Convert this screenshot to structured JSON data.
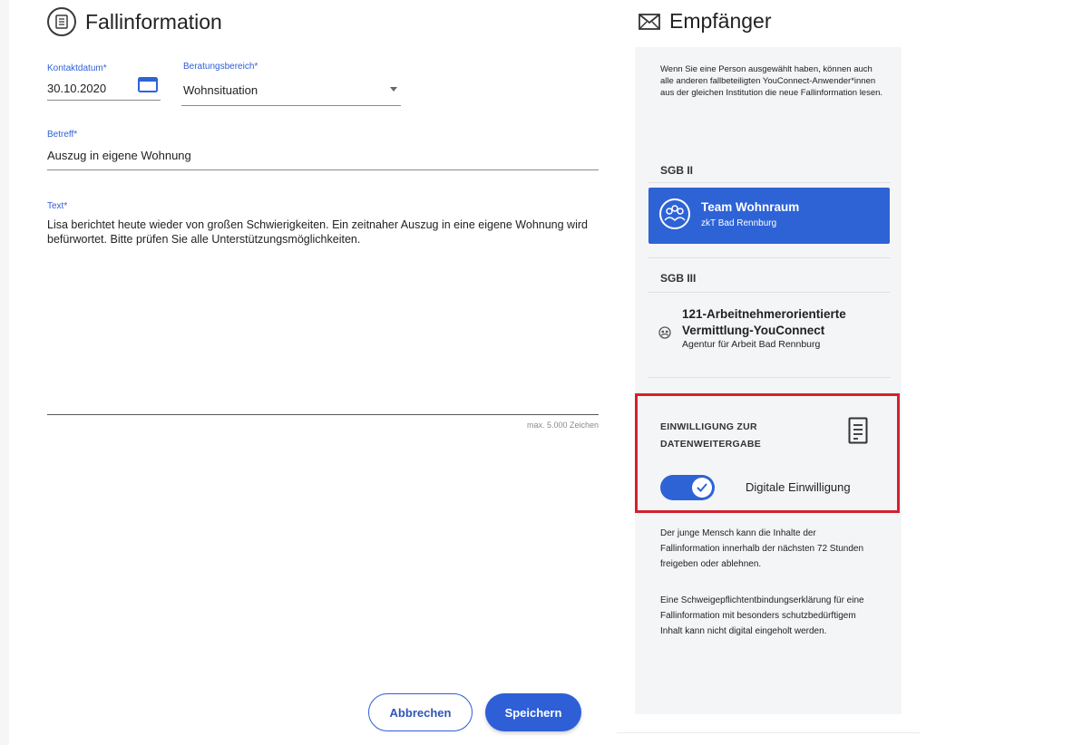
{
  "case": {
    "title": "Fallinformation",
    "contact_date_label": "Kontaktdatum*",
    "contact_date_value": "30.10.2020",
    "area_label": "Beratungsbereich*",
    "area_value": "Wohnsituation",
    "subject_label": "Betreff*",
    "subject_value": "Auszug in eigene Wohnung",
    "text_label": "Text*",
    "text_value": "Lisa berichtet heute wieder von großen Schwierigkeiten. Ein zeitnaher Auszug in eine eigene Wohnung wird befürwortet. Bitte prüfen Sie alle Unterstützungsmöglichkeiten.",
    "max_chars": "max. 5.000 Zeichen",
    "cancel_label": "Abbrechen",
    "save_label": "Speichern"
  },
  "recipients": {
    "title": "Empfänger",
    "info": "Wenn Sie eine Person ausgewählt haben, können auch alle anderen fallbeteiligten YouConnect-Anwender*innen aus der gleichen Institution die neue Fallinformation lesen.",
    "sgb2_label": "SGB II",
    "team_name": "Team Wohnraum",
    "team_org": "zkT Bad Rennburg",
    "sgb3_label": "SGB III",
    "agency_name": "121-Arbeitnehmerorientierte Vermittlung-YouConnect",
    "agency_org": "Agentur für Arbeit Bad Rennburg",
    "consent_title": "EINWILLIGUNG ZUR DATENWEITERGABE",
    "consent_toggle_label": "Digitale Einwilligung",
    "consent_enabled": true,
    "note1": "Der junge Mensch kann die Inhalte der Fallinformation innerhalb der nächsten 72 Stunden freigeben oder ablehnen.",
    "note2": "Eine Schweigepflichtentbindungserklärung für eine Fallinformation mit besonders schutzbedürftigem Inhalt kann nicht digital eingeholt werden."
  },
  "colors": {
    "accent": "#2e63d6",
    "highlight": "#d4202f"
  }
}
